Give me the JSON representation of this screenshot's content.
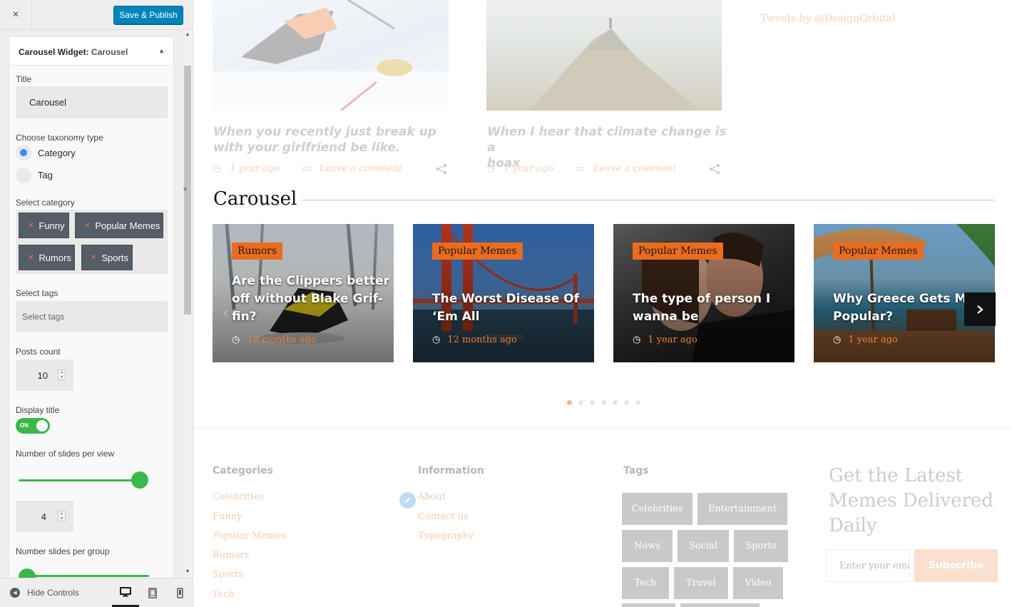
{
  "customizer": {
    "close_icon": "×",
    "publish_label": "Save & Publish",
    "widget": {
      "title_prefix": "Carousel Widget:",
      "title_name": "Carousel",
      "title_label": "Title",
      "title_value": "Carousel",
      "taxonomy_label": "Choose taxonomy type",
      "taxonomy_options": [
        {
          "label": "Category",
          "checked": true
        },
        {
          "label": "Tag",
          "checked": false
        }
      ],
      "category_label": "Select category",
      "categories": [
        "Funny",
        "Popular Memes",
        "Rumors",
        "Sports"
      ],
      "tags_label": "Select tags",
      "tags_placeholder": "Select tags",
      "posts_count_label": "Posts count",
      "posts_count_value": "10",
      "display_title_label": "Display title",
      "display_title_toggle": "ON",
      "display_title_on": true,
      "slides_per_view_label": "Number of slides per view",
      "slides_per_view_value": "4",
      "slides_per_group_label": "Number slides per group"
    },
    "footer": {
      "hide_controls_label": "Hide Controls",
      "active_device": "desktop"
    }
  },
  "preview": {
    "tweets_link": "Tweets by @DesignOrbital",
    "posts": [
      {
        "title_line1": "When you recently just break up",
        "title_line2": "with your girlfriend be like.",
        "time": "1 year ago",
        "comment": "Leave a comment"
      },
      {
        "title_line1": "When I hear that climate change is a",
        "title_line2": "hoax",
        "time": "1 year ago",
        "comment": "Leave a comment"
      }
    ],
    "carousel_heading": "Carousel",
    "slides": [
      {
        "badge": "Rumors",
        "title_line1": "Are the Clippers better",
        "title_line2": "off without Blake Grif-",
        "title_line3": "fin?",
        "time": "12 months ago"
      },
      {
        "badge": "Popular Memes",
        "title_line1": "The Worst Disease Of",
        "title_line2": "‘Em All",
        "time": "12 months ago"
      },
      {
        "badge": "Popular Memes",
        "title_line1": "The type of person I",
        "title_line2": "wanna be",
        "time": "1 year ago"
      },
      {
        "badge": "Popular Memes",
        "title_line1": "Why Greece Gets Mo",
        "title_line2": "Popular?",
        "time": "1 year ago"
      }
    ],
    "carousel_pages": 7,
    "carousel_active_page": 1,
    "footer": {
      "categories_heading": "Categories",
      "categories": [
        "Celebrities",
        "Funny",
        "Popular Memes",
        "Rumors",
        "Sports",
        "Tech"
      ],
      "information_heading": "Information",
      "information": [
        "About",
        "Contact us",
        "Typography"
      ],
      "tags_heading": "Tags",
      "tags": [
        "Celebrities",
        "Entertainment",
        "News",
        "Social",
        "Sports",
        "Tech",
        "Travel",
        "Video"
      ],
      "newsletter_title": "Get the Latest Memes Delivered Daily",
      "email_placeholder": "Enter your email",
      "subscribe_label": "Subscribe"
    }
  },
  "colors": {
    "accent_orange": "#ea6c1e",
    "publish_blue": "#0085ba",
    "toggle_green": "#3bb84a"
  }
}
